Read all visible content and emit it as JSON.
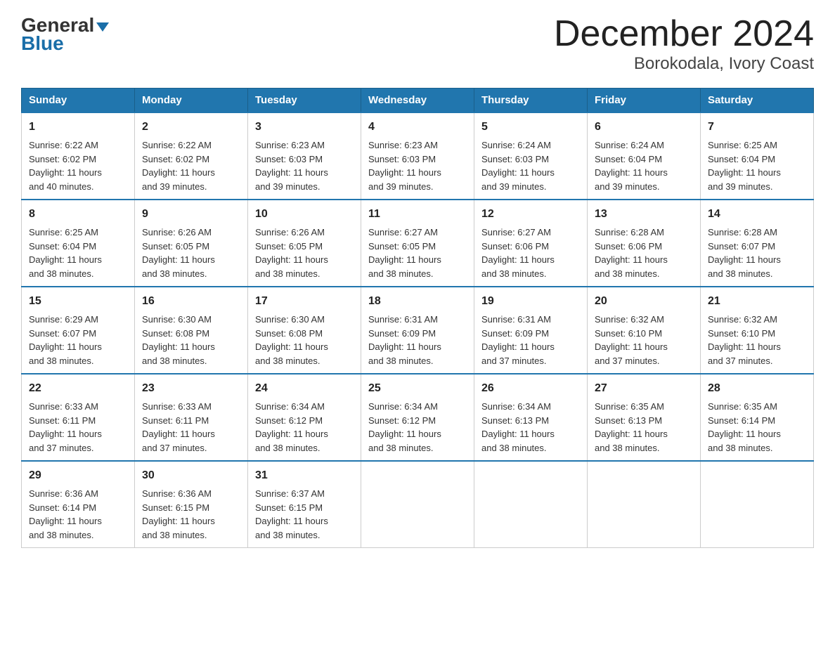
{
  "logo": {
    "general": "General",
    "blue": "Blue"
  },
  "title": "December 2024",
  "subtitle": "Borokodala, Ivory Coast",
  "days": [
    "Sunday",
    "Monday",
    "Tuesday",
    "Wednesday",
    "Thursday",
    "Friday",
    "Saturday"
  ],
  "weeks": [
    [
      {
        "day": "1",
        "sunrise": "6:22 AM",
        "sunset": "6:02 PM",
        "daylight": "11 hours and 40 minutes."
      },
      {
        "day": "2",
        "sunrise": "6:22 AM",
        "sunset": "6:02 PM",
        "daylight": "11 hours and 39 minutes."
      },
      {
        "day": "3",
        "sunrise": "6:23 AM",
        "sunset": "6:03 PM",
        "daylight": "11 hours and 39 minutes."
      },
      {
        "day": "4",
        "sunrise": "6:23 AM",
        "sunset": "6:03 PM",
        "daylight": "11 hours and 39 minutes."
      },
      {
        "day": "5",
        "sunrise": "6:24 AM",
        "sunset": "6:03 PM",
        "daylight": "11 hours and 39 minutes."
      },
      {
        "day": "6",
        "sunrise": "6:24 AM",
        "sunset": "6:04 PM",
        "daylight": "11 hours and 39 minutes."
      },
      {
        "day": "7",
        "sunrise": "6:25 AM",
        "sunset": "6:04 PM",
        "daylight": "11 hours and 39 minutes."
      }
    ],
    [
      {
        "day": "8",
        "sunrise": "6:25 AM",
        "sunset": "6:04 PM",
        "daylight": "11 hours and 38 minutes."
      },
      {
        "day": "9",
        "sunrise": "6:26 AM",
        "sunset": "6:05 PM",
        "daylight": "11 hours and 38 minutes."
      },
      {
        "day": "10",
        "sunrise": "6:26 AM",
        "sunset": "6:05 PM",
        "daylight": "11 hours and 38 minutes."
      },
      {
        "day": "11",
        "sunrise": "6:27 AM",
        "sunset": "6:05 PM",
        "daylight": "11 hours and 38 minutes."
      },
      {
        "day": "12",
        "sunrise": "6:27 AM",
        "sunset": "6:06 PM",
        "daylight": "11 hours and 38 minutes."
      },
      {
        "day": "13",
        "sunrise": "6:28 AM",
        "sunset": "6:06 PM",
        "daylight": "11 hours and 38 minutes."
      },
      {
        "day": "14",
        "sunrise": "6:28 AM",
        "sunset": "6:07 PM",
        "daylight": "11 hours and 38 minutes."
      }
    ],
    [
      {
        "day": "15",
        "sunrise": "6:29 AM",
        "sunset": "6:07 PM",
        "daylight": "11 hours and 38 minutes."
      },
      {
        "day": "16",
        "sunrise": "6:30 AM",
        "sunset": "6:08 PM",
        "daylight": "11 hours and 38 minutes."
      },
      {
        "day": "17",
        "sunrise": "6:30 AM",
        "sunset": "6:08 PM",
        "daylight": "11 hours and 38 minutes."
      },
      {
        "day": "18",
        "sunrise": "6:31 AM",
        "sunset": "6:09 PM",
        "daylight": "11 hours and 38 minutes."
      },
      {
        "day": "19",
        "sunrise": "6:31 AM",
        "sunset": "6:09 PM",
        "daylight": "11 hours and 37 minutes."
      },
      {
        "day": "20",
        "sunrise": "6:32 AM",
        "sunset": "6:10 PM",
        "daylight": "11 hours and 37 minutes."
      },
      {
        "day": "21",
        "sunrise": "6:32 AM",
        "sunset": "6:10 PM",
        "daylight": "11 hours and 37 minutes."
      }
    ],
    [
      {
        "day": "22",
        "sunrise": "6:33 AM",
        "sunset": "6:11 PM",
        "daylight": "11 hours and 37 minutes."
      },
      {
        "day": "23",
        "sunrise": "6:33 AM",
        "sunset": "6:11 PM",
        "daylight": "11 hours and 37 minutes."
      },
      {
        "day": "24",
        "sunrise": "6:34 AM",
        "sunset": "6:12 PM",
        "daylight": "11 hours and 38 minutes."
      },
      {
        "day": "25",
        "sunrise": "6:34 AM",
        "sunset": "6:12 PM",
        "daylight": "11 hours and 38 minutes."
      },
      {
        "day": "26",
        "sunrise": "6:34 AM",
        "sunset": "6:13 PM",
        "daylight": "11 hours and 38 minutes."
      },
      {
        "day": "27",
        "sunrise": "6:35 AM",
        "sunset": "6:13 PM",
        "daylight": "11 hours and 38 minutes."
      },
      {
        "day": "28",
        "sunrise": "6:35 AM",
        "sunset": "6:14 PM",
        "daylight": "11 hours and 38 minutes."
      }
    ],
    [
      {
        "day": "29",
        "sunrise": "6:36 AM",
        "sunset": "6:14 PM",
        "daylight": "11 hours and 38 minutes."
      },
      {
        "day": "30",
        "sunrise": "6:36 AM",
        "sunset": "6:15 PM",
        "daylight": "11 hours and 38 minutes."
      },
      {
        "day": "31",
        "sunrise": "6:37 AM",
        "sunset": "6:15 PM",
        "daylight": "11 hours and 38 minutes."
      },
      null,
      null,
      null,
      null
    ]
  ]
}
